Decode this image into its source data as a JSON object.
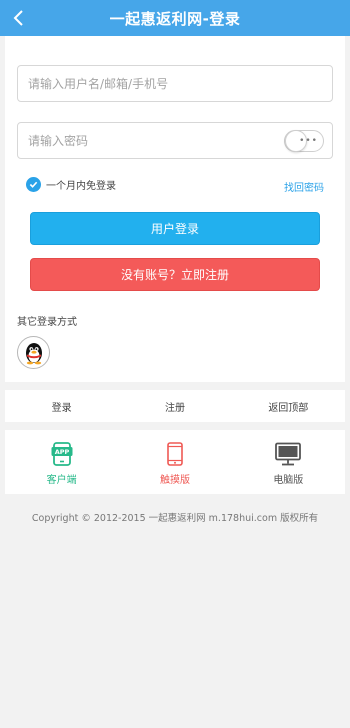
{
  "header": {
    "title": "一起惠返利网-登录",
    "back_icon": "chevron-left-icon"
  },
  "login_form": {
    "username_placeholder": "请输入用户名/邮箱/手机号",
    "password_placeholder": "请输入密码",
    "remember_label": "一个月内免登录",
    "remember_checked": true,
    "forgot_label": "找回密码",
    "login_button": "用户登录",
    "register_button": "没有账号？立即注册",
    "toggle_icon": "more-dots-icon"
  },
  "other_login": {
    "title": "其它登录方式",
    "qq_icon": "qq-penguin-icon"
  },
  "footer_nav": {
    "items": [
      "登录",
      "注册",
      "返回顶部"
    ]
  },
  "versions": {
    "items": [
      {
        "label": "客户端",
        "icon": "app-icon"
      },
      {
        "label": "触摸版",
        "icon": "phone-icon"
      },
      {
        "label": "电脑版",
        "icon": "monitor-icon"
      }
    ]
  },
  "copyright": "Copyright © 2012-2015 一起惠返利网 m.178hui.com 版权所有",
  "colors": {
    "header": "#46a6e9",
    "accent": "#2aa2e8",
    "login_button": "#22b0ee",
    "register_button": "#f45a59",
    "app_green": "#27b98a",
    "touch_red": "#ef5a55"
  }
}
